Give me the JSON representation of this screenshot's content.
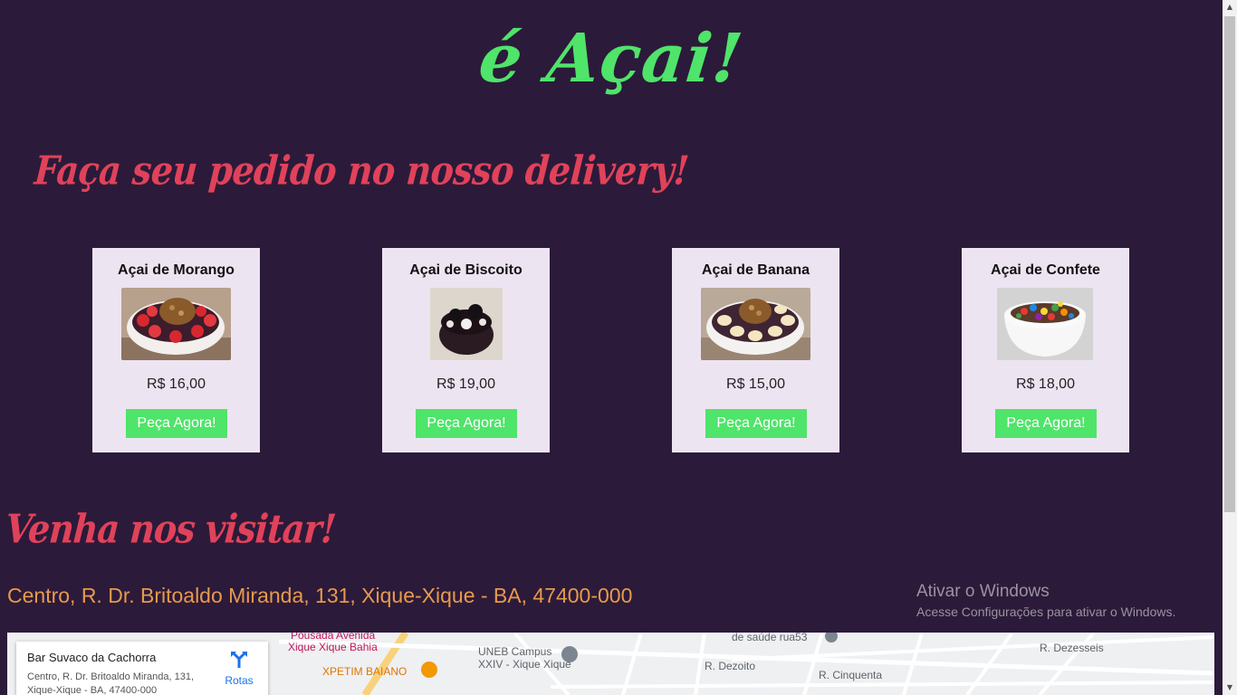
{
  "header": {
    "logo": "é Açai!"
  },
  "delivery": {
    "title": "Faça seu pedido no nosso delivery!"
  },
  "products": [
    {
      "name": "Açai de Morango",
      "price": "R$ 16,00",
      "button": "Peça Agora!",
      "image": "acai-morango-bowl"
    },
    {
      "name": "Açai de Biscoito",
      "price": "R$ 19,00",
      "button": "Peça Agora!",
      "image": "acai-biscoito-bowl"
    },
    {
      "name": "Açai de Banana",
      "price": "R$ 15,00",
      "button": "Peça Agora!",
      "image": "acai-banana-bowl"
    },
    {
      "name": "Açai de Confete",
      "price": "R$ 18,00",
      "button": "Peça Agora!",
      "image": "acai-confete-bowl"
    }
  ],
  "visit": {
    "title": "Venha nos visitar!",
    "address": "Centro, R. Dr. Britoaldo Miranda, 131, Xique-Xique - BA, 47400-000"
  },
  "map": {
    "place_name": "Bar Suvaco da Cachorra",
    "place_address": "Centro, R. Dr. Britoaldo Miranda, 131, Xique-Xique - BA, 47400-000",
    "route_label": "Rotas",
    "labels": [
      "Pousada Avenida",
      "Xique Xique Bahia",
      "XPETIM BAIANO",
      "UNEB Campus",
      "XXIV - Xique Xique",
      "R. Dezoito",
      "R. Cinquenta",
      "R. Dezesseis",
      "de saúde rua53"
    ]
  },
  "windows_activation": {
    "title": "Ativar o Windows",
    "subtitle": "Acesse Configurações para ativar o Windows."
  },
  "colors": {
    "background": "#2c1a3a",
    "accent_green": "#4fe46a",
    "heading_red": "#e0425a",
    "address_orange": "#e69a4d",
    "card_bg": "#ede4f1"
  }
}
